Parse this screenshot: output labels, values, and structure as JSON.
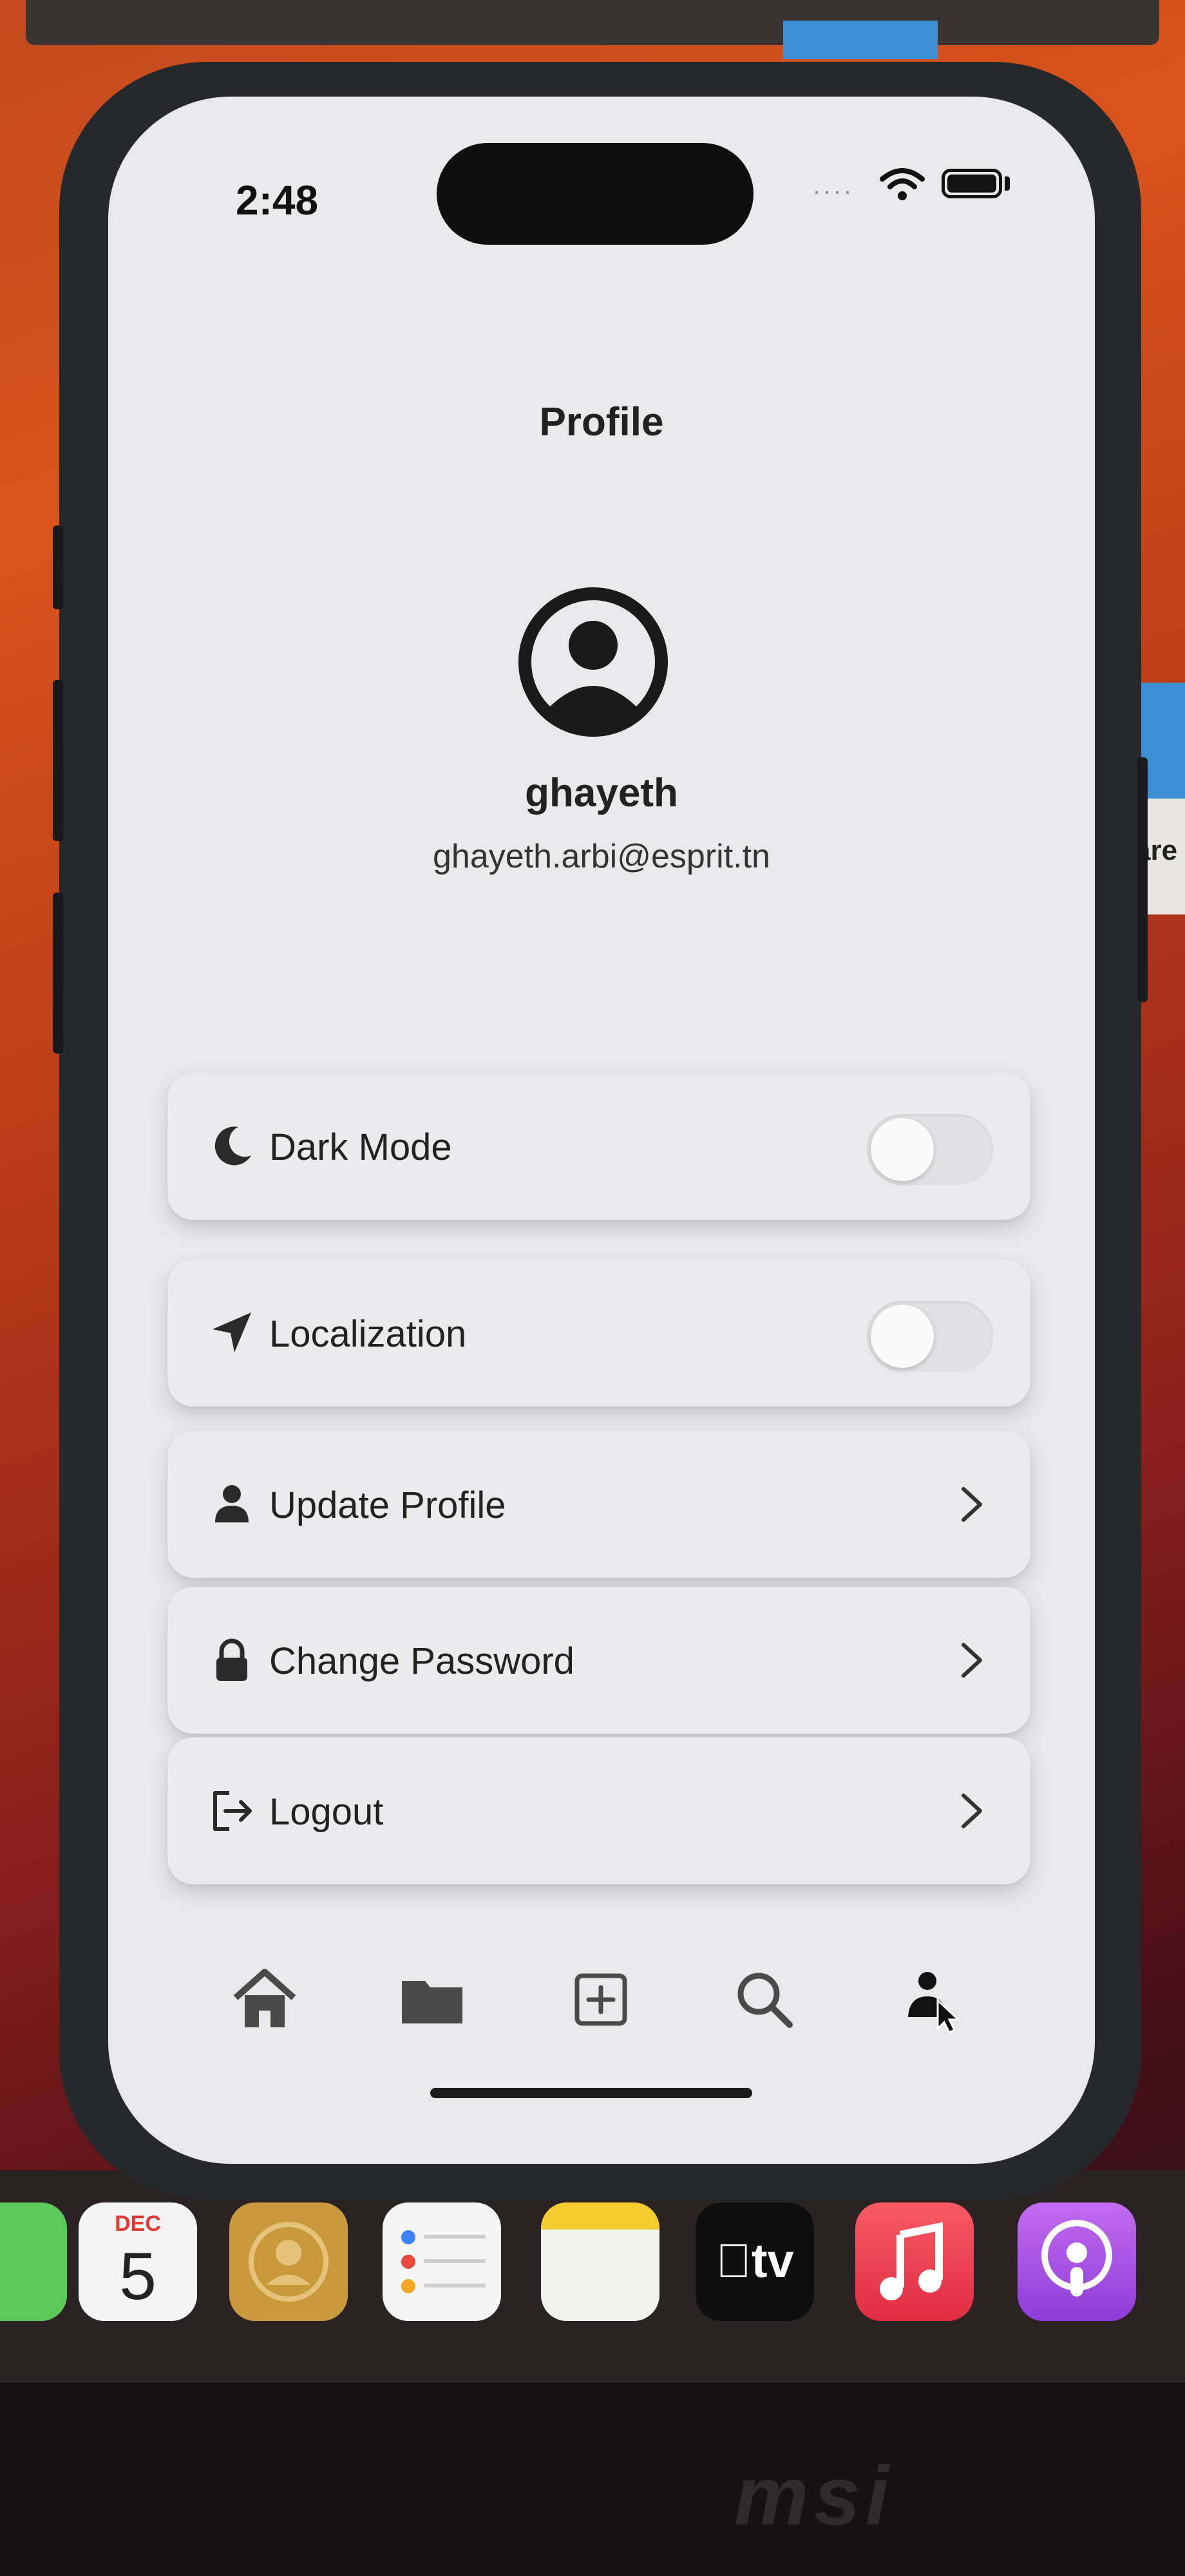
{
  "status_bar": {
    "time": "2:48",
    "signal_dots": "····"
  },
  "header": {
    "title": "Profile"
  },
  "profile": {
    "username": "ghayeth",
    "email": "ghayeth.arbi@esprit.tn",
    "avatar_icon": "person-circle-icon"
  },
  "settings": {
    "dark_mode": {
      "label": "Dark Mode",
      "icon": "moon-icon",
      "enabled": false
    },
    "localization": {
      "label": "Localization",
      "icon": "location-arrow-icon",
      "enabled": false
    },
    "update_profile": {
      "label": "Update Profile",
      "icon": "person-icon"
    },
    "change_password": {
      "label": "Change Password",
      "icon": "lock-icon"
    },
    "logout": {
      "label": "Logout",
      "icon": "logout-icon"
    }
  },
  "tab_bar": {
    "items": [
      {
        "name": "home",
        "icon": "home-icon"
      },
      {
        "name": "folder",
        "icon": "folder-icon"
      },
      {
        "name": "add",
        "icon": "plus-square-icon"
      },
      {
        "name": "search",
        "icon": "search-icon"
      },
      {
        "name": "profile",
        "icon": "person-icon",
        "active": true
      }
    ]
  },
  "dock": {
    "calendar": {
      "month": "DEC",
      "day": "5"
    },
    "tv": {
      "label": "tv"
    }
  },
  "desktop": {
    "side_text": "are",
    "brand": "msi"
  },
  "colors": {
    "background": "#e9e9ec",
    "text": "#222222",
    "accent_dark": "#1c1c1e"
  }
}
